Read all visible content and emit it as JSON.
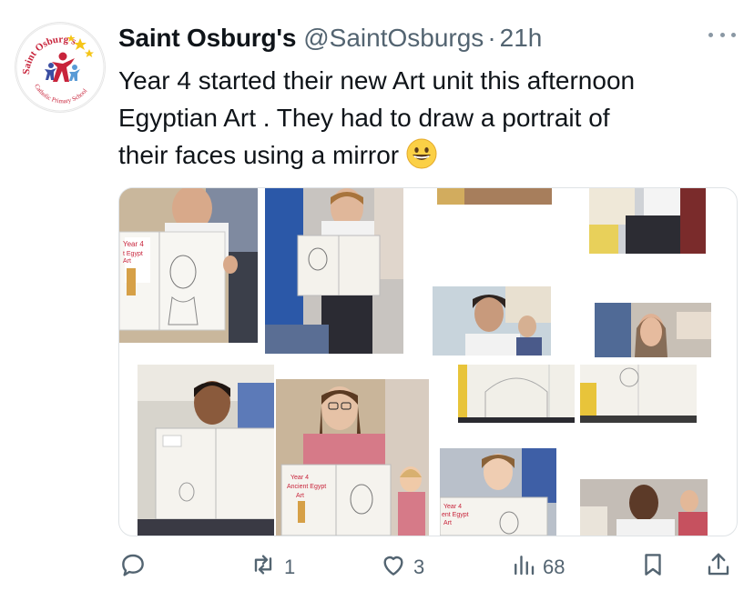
{
  "tweet": {
    "display_name": "Saint Osburg's",
    "handle": "@SaintOsburgs",
    "separator": "·",
    "time": "21h",
    "text_lines": [
      "Year 4 started their new Art unit this afternoon",
      "Egyptian Art . They had to draw a portrait of",
      "their faces using a mirror"
    ],
    "emoji": "grinning-face-emoji"
  },
  "avatar": {
    "logo_text_top": "Saint Osburg's",
    "logo_text_bottom": "Catholic Primary School",
    "colors": [
      "#c8243b",
      "#f5c518",
      "#3b4ea2"
    ]
  },
  "media": {
    "photo_count": 12,
    "drawing_labels": [
      "Year 4",
      "Ancient Egypt",
      "Art"
    ]
  },
  "actions": {
    "reply_count": "",
    "retweet_count": "1",
    "like_count": "3",
    "views_count": "68"
  },
  "colors": {
    "text_primary": "#0f1419",
    "text_secondary": "#536471",
    "border": "#dfe3e6"
  }
}
